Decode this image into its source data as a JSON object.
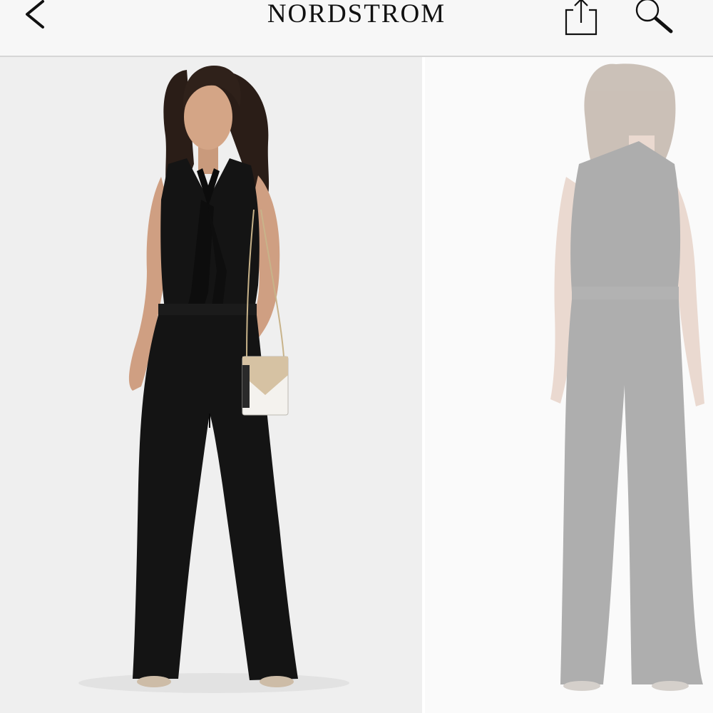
{
  "header": {
    "brand": "NORDSTROM",
    "back_icon": "chevron-left-icon",
    "share_icon": "share-icon",
    "search_icon": "search-icon"
  },
  "gallery": {
    "images": [
      {
        "view": "front",
        "icon": "model-front-photo"
      },
      {
        "view": "back",
        "icon": "model-back-photo"
      }
    ]
  },
  "colors": {
    "header_bg": "#f7f7f7",
    "garment": "#141414",
    "photo_bg": "#efefef"
  }
}
